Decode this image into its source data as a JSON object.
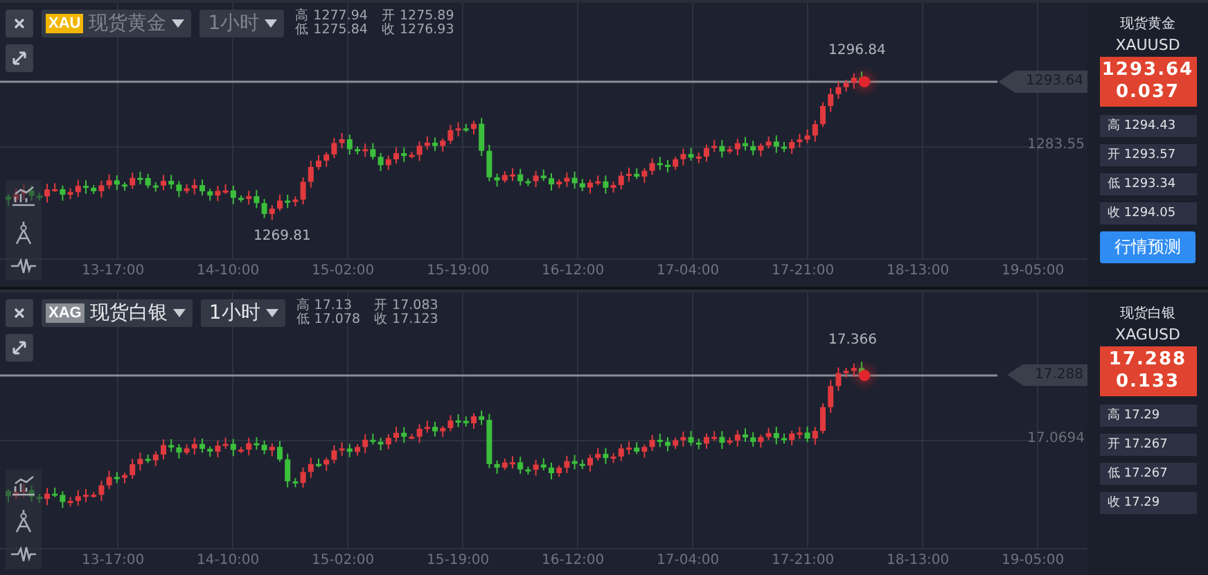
{
  "panels": [
    {
      "badge": {
        "text": "XAU",
        "color": "#f2b705"
      },
      "name": "现货黄金",
      "name_dimmed": true,
      "interval": "1小时",
      "ohlc": [
        {
          "label": "高",
          "value": "1277.94"
        },
        {
          "label": "开",
          "value": "1275.89"
        },
        {
          "label": "低",
          "value": "1275.84"
        },
        {
          "label": "收",
          "value": "1276.93"
        }
      ],
      "chart": {
        "high_label": "1296.84",
        "low_label": "1269.81",
        "price_tag": "1293.64",
        "grid_label": "1283.55",
        "x_labels": [
          "13-17:00",
          "14-10:00",
          "15-02:00",
          "15-19:00",
          "16-12:00",
          "17-04:00",
          "17-21:00",
          "18-13:00",
          "19-05:00"
        ]
      },
      "sidebar": {
        "title": "现货黄金",
        "symbol": "XAUUSD",
        "price": "1293.64",
        "change": "0.037",
        "stats": [
          {
            "label": "高",
            "value": "1294.43"
          },
          {
            "label": "开",
            "value": "1293.57"
          },
          {
            "label": "低",
            "value": "1293.34"
          },
          {
            "label": "收",
            "value": "1294.05"
          }
        ],
        "button": "行情预测"
      }
    },
    {
      "badge": {
        "text": "XAG",
        "color": "#8a8d94"
      },
      "name": "现货白银",
      "name_dimmed": false,
      "interval": "1小时",
      "ohlc": [
        {
          "label": "高",
          "value": "17.13"
        },
        {
          "label": "开",
          "value": "17.083"
        },
        {
          "label": "低",
          "value": "17.078"
        },
        {
          "label": "收",
          "value": "17.123"
        }
      ],
      "chart": {
        "high_label": "17.366",
        "price_tag": "17.288",
        "grid_label": "17.0694",
        "x_labels": [
          "13-17:00",
          "14-10:00",
          "15-02:00",
          "15-19:00",
          "16-12:00",
          "17-04:00",
          "17-21:00",
          "18-13:00",
          "19-05:00"
        ]
      },
      "sidebar": {
        "title": "现货白银",
        "symbol": "XAGUSD",
        "price": "17.288",
        "change": "0.133",
        "stats": [
          {
            "label": "高",
            "value": "17.29"
          },
          {
            "label": "开",
            "value": "17.267"
          },
          {
            "label": "低",
            "value": "17.267"
          },
          {
            "label": "收",
            "value": "17.29"
          }
        ]
      }
    }
  ]
}
